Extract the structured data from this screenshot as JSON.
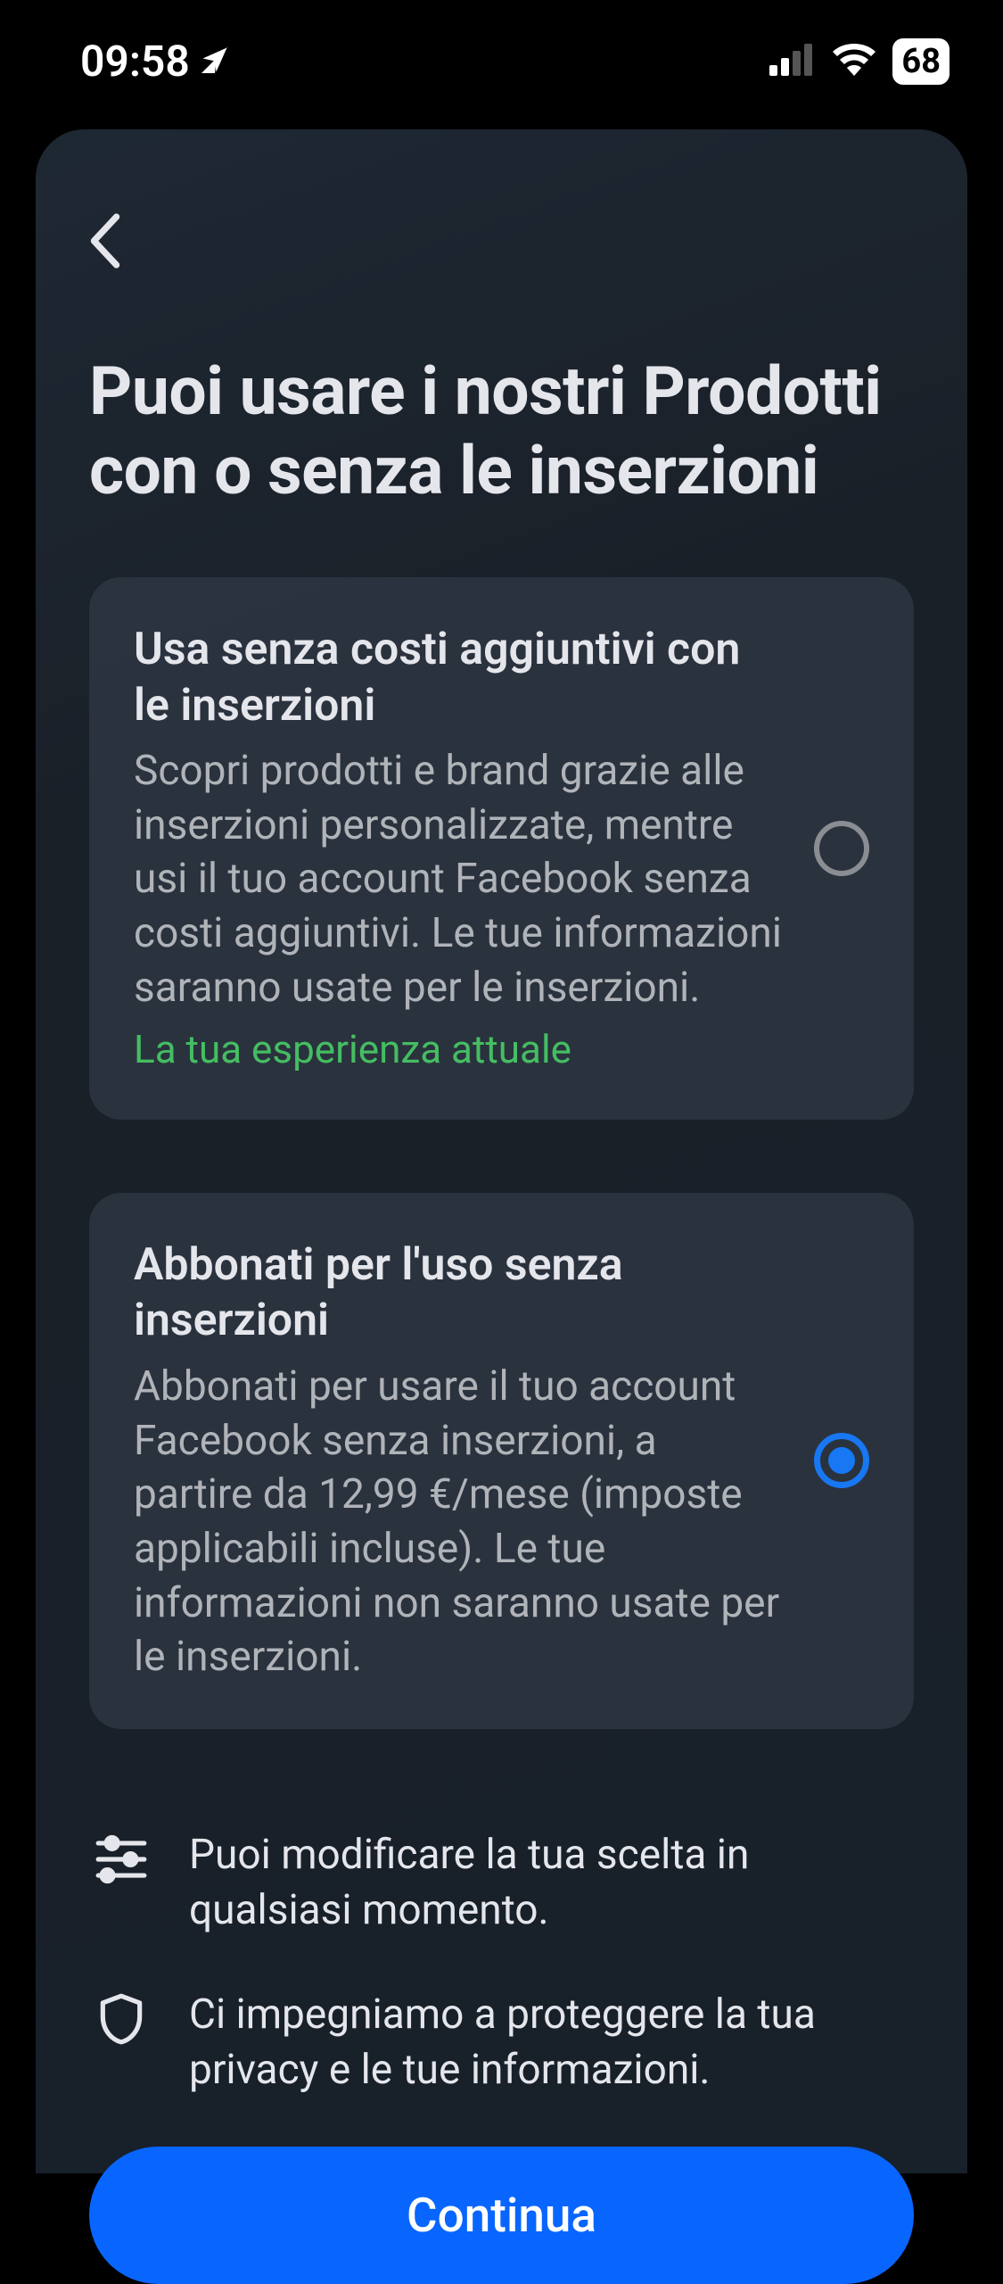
{
  "status": {
    "time": "09:58",
    "battery": "68"
  },
  "page": {
    "title": "Puoi usare i nostri Prodotti con o senza le inserzioni"
  },
  "options": [
    {
      "title": "Usa senza costi aggiuntivi con le inserzioni",
      "desc": "Scopri prodotti e brand grazie alle inserzioni personalizzate, mentre usi il tuo account Facebook senza costi aggiuntivi. Le tue informazioni saranno usate per le inserzioni.",
      "badge": "La tua esperienza attuale",
      "selected": false
    },
    {
      "title": "Abbonati per l'uso senza inserzioni",
      "desc": "Abbonati per usare il tuo account Facebook senza inserzioni, a partire da 12,99 €/mese (imposte applicabili incluse). Le tue informazioni non saranno usate per le inserzioni.",
      "badge": "",
      "selected": true
    }
  ],
  "info": [
    "Puoi modificare la tua scelta in qualsiasi momento.",
    "Ci impegniamo a proteggere la tua privacy e le tue informazioni."
  ],
  "cta": {
    "continue": "Continua"
  }
}
